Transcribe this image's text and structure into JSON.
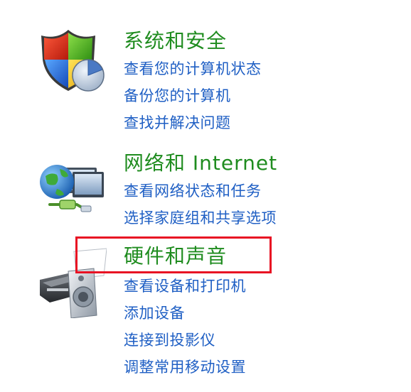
{
  "categories": [
    {
      "title": "系统和安全",
      "icon": "security-shield-icon",
      "links": [
        "查看您的计算机状态",
        "备份您的计算机",
        "查找并解决问题"
      ]
    },
    {
      "title": "网络和 Internet",
      "icon": "network-globe-icon",
      "links": [
        "查看网络状态和任务",
        "选择家庭组和共享选项"
      ]
    },
    {
      "title": "硬件和声音",
      "icon": "printer-speaker-icon",
      "links": [
        "查看设备和打印机",
        "添加设备",
        "连接到投影仪",
        "调整常用移动设置"
      ]
    }
  ],
  "colors": {
    "title": "#1f8c1f",
    "link": "#1f5fc4",
    "highlight": "#e81123"
  }
}
